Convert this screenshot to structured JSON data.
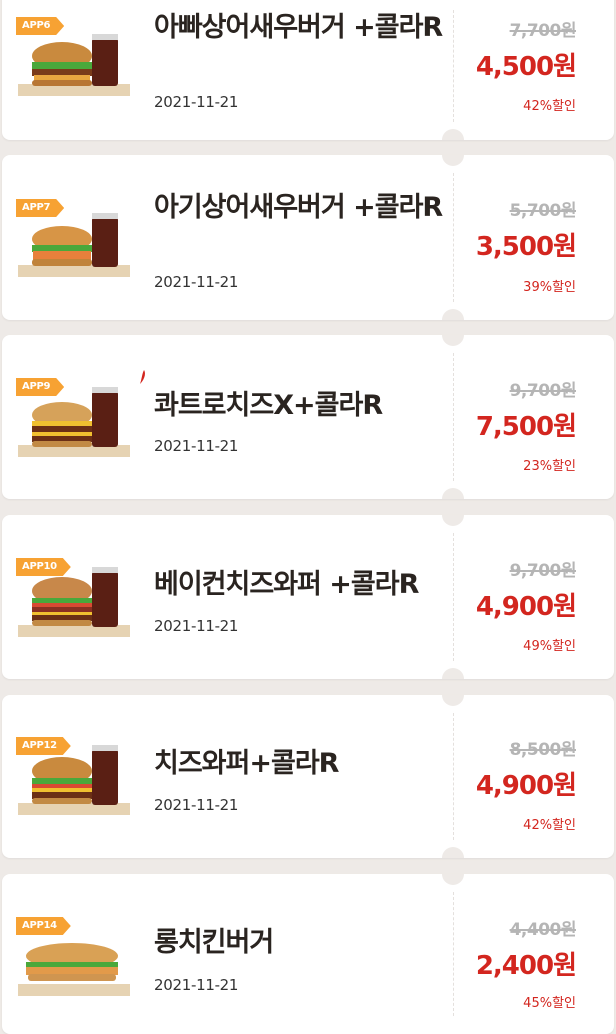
{
  "coupons": [
    {
      "code": "APP6",
      "name": "아빠상어새우버거 +콜라R",
      "date": "2021-11-21",
      "original_price": "7,700원",
      "sale_price": "4,500원",
      "discount": "42%할인",
      "icon": "burger-combo-icon"
    },
    {
      "code": "APP7",
      "name": "아기상어새우버거 +콜라R",
      "date": "2021-11-21",
      "original_price": "5,700원",
      "sale_price": "3,500원",
      "discount": "39%할인",
      "icon": "burger-combo-icon"
    },
    {
      "code": "APP9",
      "name": "콰트로치즈X+콜라R",
      "date": "2021-11-21",
      "original_price": "9,700원",
      "sale_price": "7,500원",
      "discount": "23%할인",
      "icon": "burger-combo-icon",
      "spicy_icon": "chili-pepper-icon"
    },
    {
      "code": "APP10",
      "name": "베이컨치즈와퍼 +콜라R",
      "date": "2021-11-21",
      "original_price": "9,700원",
      "sale_price": "4,900원",
      "discount": "49%할인",
      "icon": "burger-combo-icon"
    },
    {
      "code": "APP12",
      "name": "치즈와퍼+콜라R",
      "date": "2021-11-21",
      "original_price": "8,500원",
      "sale_price": "4,900원",
      "discount": "42%할인",
      "icon": "burger-combo-icon"
    },
    {
      "code": "APP14",
      "name": "롱치킨버거",
      "date": "2021-11-21",
      "original_price": "4,400원",
      "sale_price": "2,400원",
      "discount": "45%할인",
      "icon": "long-burger-icon"
    }
  ],
  "colors": {
    "accent": "#d3261f",
    "badge": "#f7a233",
    "background": "#eeeae7"
  }
}
